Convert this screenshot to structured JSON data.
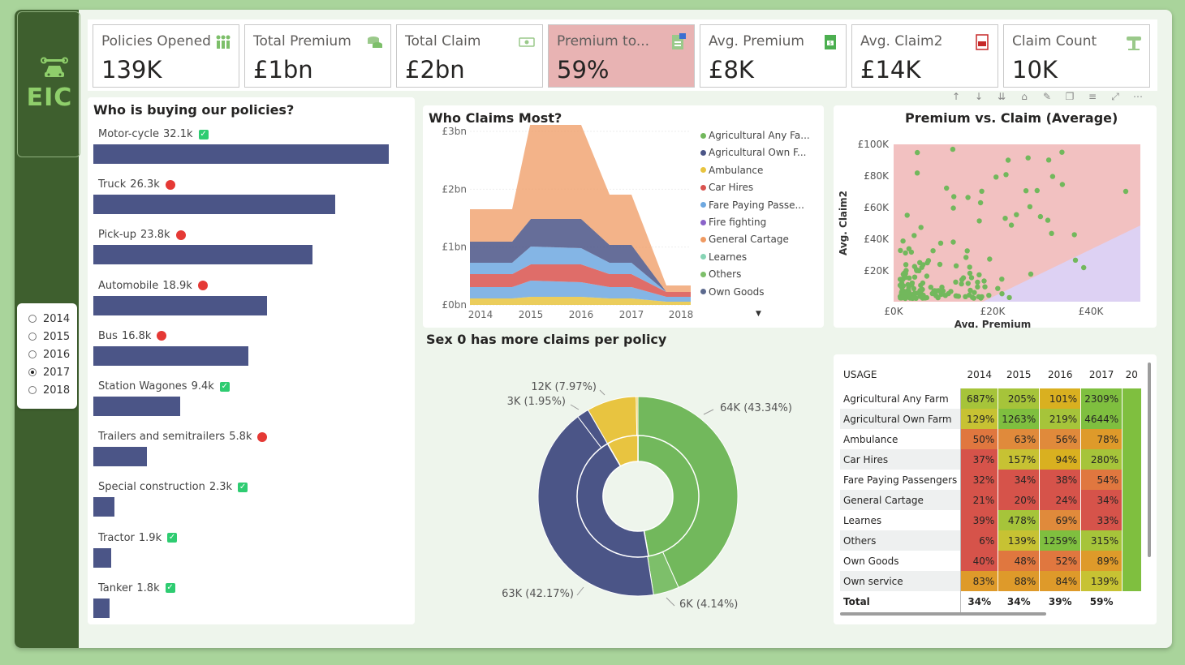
{
  "logo": {
    "text": "EIC"
  },
  "year_slicer": {
    "options": [
      {
        "label": "2014",
        "selected": false
      },
      {
        "label": "2015",
        "selected": false
      },
      {
        "label": "2016",
        "selected": false
      },
      {
        "label": "2017",
        "selected": true
      },
      {
        "label": "2018",
        "selected": false
      }
    ]
  },
  "kpis": [
    {
      "title": "Policies Opened",
      "value": "139K",
      "icon": "people-icon"
    },
    {
      "title": "Total Premium",
      "value": "£1bn",
      "icon": "coins-icon"
    },
    {
      "title": "Total Claim",
      "value": "£2bn",
      "icon": "cash-icon"
    },
    {
      "title": "Premium to...",
      "value": "59%",
      "icon": "document-icon"
    },
    {
      "title": "Avg. Premium",
      "value": "£8K",
      "icon": "money-doc-icon"
    },
    {
      "title": "Avg. Claim2",
      "value": "£14K",
      "icon": "claim-doc-icon"
    },
    {
      "title": "Claim Count",
      "value": "10K",
      "icon": "car-lift-icon"
    }
  ],
  "policies": {
    "title": "Who is buying our policies?",
    "items": [
      {
        "name": "Motor-cycle",
        "value": 32.1,
        "label": "32.1k",
        "status": "check"
      },
      {
        "name": "Truck",
        "value": 26.3,
        "label": "26.3k",
        "status": "dot"
      },
      {
        "name": "Pick-up",
        "value": 23.8,
        "label": "23.8k",
        "status": "dot"
      },
      {
        "name": "Automobile",
        "value": 18.9,
        "label": "18.9k",
        "status": "dot"
      },
      {
        "name": "Bus",
        "value": 16.8,
        "label": "16.8k",
        "status": "dot"
      },
      {
        "name": "Station Wagones",
        "value": 9.4,
        "label": "9.4k",
        "status": "check"
      },
      {
        "name": "Trailers and semitrailers",
        "value": 5.8,
        "label": "5.8k",
        "status": "dot"
      },
      {
        "name": "Special construction",
        "value": 2.3,
        "label": "2.3k",
        "status": "check"
      },
      {
        "name": "Tractor",
        "value": 1.9,
        "label": "1.9k",
        "status": "check"
      },
      {
        "name": "Tanker",
        "value": 1.8,
        "label": "1.8k",
        "status": "check"
      }
    ]
  },
  "claims_chart": {
    "title": "Who Claims Most?",
    "yticks": [
      "£3bn",
      "£2bn",
      "£1bn",
      "£0bn"
    ],
    "xticks": [
      "2014",
      "2015",
      "2016",
      "2017",
      "2018"
    ],
    "legend": [
      {
        "name": "Agricultural Any Fa...",
        "color": "#72b85c"
      },
      {
        "name": "Agricultural Own F...",
        "color": "#4b5587"
      },
      {
        "name": "Ambulance",
        "color": "#e8c440"
      },
      {
        "name": "Car Hires",
        "color": "#d9534f"
      },
      {
        "name": "Fare Paying Passe...",
        "color": "#6ea8e0"
      },
      {
        "name": "Fire fighting",
        "color": "#8a63c9"
      },
      {
        "name": "General Cartage",
        "color": "#ef9a62"
      },
      {
        "name": "Learnes",
        "color": "#86d4b4"
      },
      {
        "name": "Others",
        "color": "#7dbf6a"
      },
      {
        "name": "Own Goods",
        "color": "#5c6a8e"
      }
    ]
  },
  "scatter": {
    "title": "Premium vs. Claim (Average)",
    "xlabel": "Avg. Premium",
    "ylabel": "Avg. Claim2",
    "yticks": [
      "£100K",
      "£80K",
      "£60K",
      "£40K",
      "£20K"
    ],
    "xticks": [
      "£0K",
      "£20K",
      "£40K"
    ]
  },
  "donut": {
    "title": "Sex 0 has more claims per policy",
    "labels": [
      "64K (43.34%)",
      "6K (4.14%)",
      "63K (42.17%)",
      "3K (1.95%)",
      "12K (7.97%)"
    ]
  },
  "matrix": {
    "headers": [
      "USAGE",
      "2014",
      "2015",
      "2016",
      "2017",
      "20"
    ],
    "rows": [
      {
        "usage": "Agricultural Any Farm",
        "cells": [
          "687%",
          "205%",
          "101%",
          "2309%"
        ]
      },
      {
        "usage": "Agricultural Own Farm",
        "cells": [
          "129%",
          "1263%",
          "219%",
          "4644%"
        ]
      },
      {
        "usage": "Ambulance",
        "cells": [
          "50%",
          "63%",
          "56%",
          "78%"
        ]
      },
      {
        "usage": "Car Hires",
        "cells": [
          "37%",
          "157%",
          "94%",
          "280%"
        ]
      },
      {
        "usage": "Fare Paying Passengers",
        "cells": [
          "32%",
          "34%",
          "38%",
          "54%"
        ]
      },
      {
        "usage": "General Cartage",
        "cells": [
          "21%",
          "20%",
          "24%",
          "34%"
        ]
      },
      {
        "usage": "Learnes",
        "cells": [
          "39%",
          "478%",
          "69%",
          "33%"
        ]
      },
      {
        "usage": "Others",
        "cells": [
          "6%",
          "139%",
          "1259%",
          "315%"
        ]
      },
      {
        "usage": "Own Goods",
        "cells": [
          "40%",
          "48%",
          "52%",
          "89%"
        ]
      },
      {
        "usage": "Own service",
        "cells": [
          "83%",
          "88%",
          "84%",
          "139%"
        ]
      }
    ],
    "total": {
      "label": "Total",
      "cells": [
        "34%",
        "34%",
        "39%",
        "59%"
      ]
    }
  }
}
